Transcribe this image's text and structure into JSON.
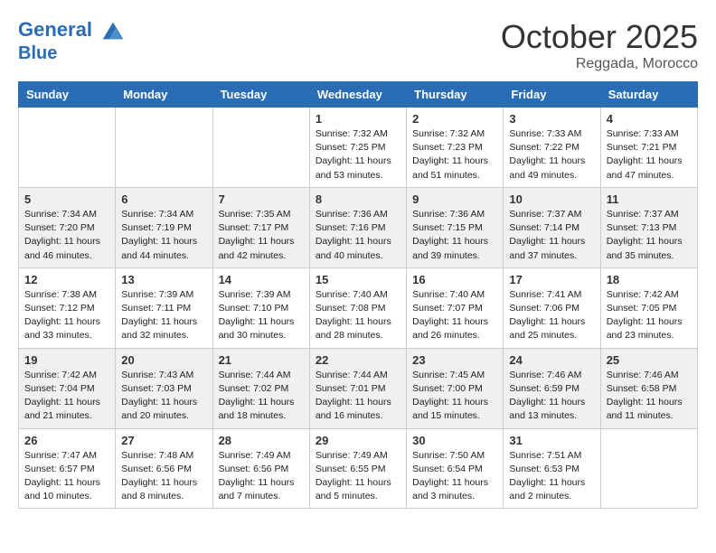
{
  "header": {
    "logo_line1": "General",
    "logo_line2": "Blue",
    "month": "October 2025",
    "location": "Reggada, Morocco"
  },
  "weekdays": [
    "Sunday",
    "Monday",
    "Tuesday",
    "Wednesday",
    "Thursday",
    "Friday",
    "Saturday"
  ],
  "weeks": [
    [
      {
        "day": "",
        "info": ""
      },
      {
        "day": "",
        "info": ""
      },
      {
        "day": "",
        "info": ""
      },
      {
        "day": "1",
        "info": "Sunrise: 7:32 AM\nSunset: 7:25 PM\nDaylight: 11 hours and 53 minutes."
      },
      {
        "day": "2",
        "info": "Sunrise: 7:32 AM\nSunset: 7:23 PM\nDaylight: 11 hours and 51 minutes."
      },
      {
        "day": "3",
        "info": "Sunrise: 7:33 AM\nSunset: 7:22 PM\nDaylight: 11 hours and 49 minutes."
      },
      {
        "day": "4",
        "info": "Sunrise: 7:33 AM\nSunset: 7:21 PM\nDaylight: 11 hours and 47 minutes."
      }
    ],
    [
      {
        "day": "5",
        "info": "Sunrise: 7:34 AM\nSunset: 7:20 PM\nDaylight: 11 hours and 46 minutes."
      },
      {
        "day": "6",
        "info": "Sunrise: 7:34 AM\nSunset: 7:19 PM\nDaylight: 11 hours and 44 minutes."
      },
      {
        "day": "7",
        "info": "Sunrise: 7:35 AM\nSunset: 7:17 PM\nDaylight: 11 hours and 42 minutes."
      },
      {
        "day": "8",
        "info": "Sunrise: 7:36 AM\nSunset: 7:16 PM\nDaylight: 11 hours and 40 minutes."
      },
      {
        "day": "9",
        "info": "Sunrise: 7:36 AM\nSunset: 7:15 PM\nDaylight: 11 hours and 39 minutes."
      },
      {
        "day": "10",
        "info": "Sunrise: 7:37 AM\nSunset: 7:14 PM\nDaylight: 11 hours and 37 minutes."
      },
      {
        "day": "11",
        "info": "Sunrise: 7:37 AM\nSunset: 7:13 PM\nDaylight: 11 hours and 35 minutes."
      }
    ],
    [
      {
        "day": "12",
        "info": "Sunrise: 7:38 AM\nSunset: 7:12 PM\nDaylight: 11 hours and 33 minutes."
      },
      {
        "day": "13",
        "info": "Sunrise: 7:39 AM\nSunset: 7:11 PM\nDaylight: 11 hours and 32 minutes."
      },
      {
        "day": "14",
        "info": "Sunrise: 7:39 AM\nSunset: 7:10 PM\nDaylight: 11 hours and 30 minutes."
      },
      {
        "day": "15",
        "info": "Sunrise: 7:40 AM\nSunset: 7:08 PM\nDaylight: 11 hours and 28 minutes."
      },
      {
        "day": "16",
        "info": "Sunrise: 7:40 AM\nSunset: 7:07 PM\nDaylight: 11 hours and 26 minutes."
      },
      {
        "day": "17",
        "info": "Sunrise: 7:41 AM\nSunset: 7:06 PM\nDaylight: 11 hours and 25 minutes."
      },
      {
        "day": "18",
        "info": "Sunrise: 7:42 AM\nSunset: 7:05 PM\nDaylight: 11 hours and 23 minutes."
      }
    ],
    [
      {
        "day": "19",
        "info": "Sunrise: 7:42 AM\nSunset: 7:04 PM\nDaylight: 11 hours and 21 minutes."
      },
      {
        "day": "20",
        "info": "Sunrise: 7:43 AM\nSunset: 7:03 PM\nDaylight: 11 hours and 20 minutes."
      },
      {
        "day": "21",
        "info": "Sunrise: 7:44 AM\nSunset: 7:02 PM\nDaylight: 11 hours and 18 minutes."
      },
      {
        "day": "22",
        "info": "Sunrise: 7:44 AM\nSunset: 7:01 PM\nDaylight: 11 hours and 16 minutes."
      },
      {
        "day": "23",
        "info": "Sunrise: 7:45 AM\nSunset: 7:00 PM\nDaylight: 11 hours and 15 minutes."
      },
      {
        "day": "24",
        "info": "Sunrise: 7:46 AM\nSunset: 6:59 PM\nDaylight: 11 hours and 13 minutes."
      },
      {
        "day": "25",
        "info": "Sunrise: 7:46 AM\nSunset: 6:58 PM\nDaylight: 11 hours and 11 minutes."
      }
    ],
    [
      {
        "day": "26",
        "info": "Sunrise: 7:47 AM\nSunset: 6:57 PM\nDaylight: 11 hours and 10 minutes."
      },
      {
        "day": "27",
        "info": "Sunrise: 7:48 AM\nSunset: 6:56 PM\nDaylight: 11 hours and 8 minutes."
      },
      {
        "day": "28",
        "info": "Sunrise: 7:49 AM\nSunset: 6:56 PM\nDaylight: 11 hours and 7 minutes."
      },
      {
        "day": "29",
        "info": "Sunrise: 7:49 AM\nSunset: 6:55 PM\nDaylight: 11 hours and 5 minutes."
      },
      {
        "day": "30",
        "info": "Sunrise: 7:50 AM\nSunset: 6:54 PM\nDaylight: 11 hours and 3 minutes."
      },
      {
        "day": "31",
        "info": "Sunrise: 7:51 AM\nSunset: 6:53 PM\nDaylight: 11 hours and 2 minutes."
      },
      {
        "day": "",
        "info": ""
      }
    ]
  ]
}
